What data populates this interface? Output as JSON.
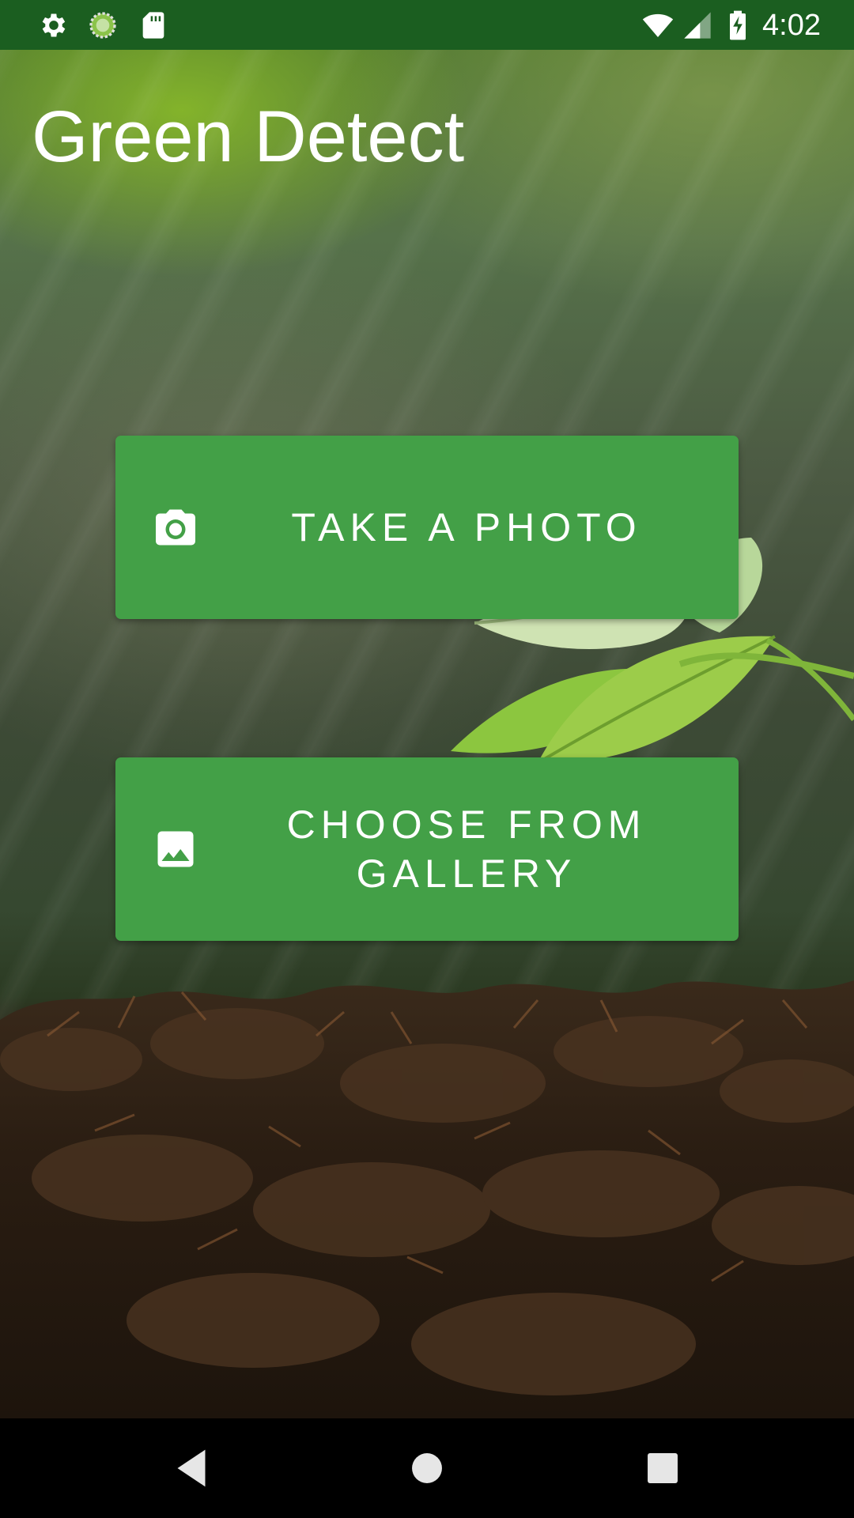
{
  "status_bar": {
    "time": "4:02",
    "left_icons": [
      "settings-icon",
      "sync-icon",
      "sd-card-icon"
    ],
    "right_icons": [
      "wifi-icon",
      "cell-signal-icon",
      "battery-charging-icon"
    ]
  },
  "app": {
    "title": "Green Detect"
  },
  "actions": {
    "take_photo": {
      "label": "TAKE A PHOTO",
      "icon": "camera-icon"
    },
    "choose_gallery": {
      "label": "CHOOSE FROM GALLERY",
      "icon": "image-icon"
    }
  },
  "navigation": {
    "buttons": [
      "back-icon",
      "home-icon",
      "recents-icon"
    ]
  },
  "colors": {
    "status_bar": "#1b5e20",
    "button": "#43a047",
    "button_text": "#ffffff",
    "nav_bar": "#000000"
  }
}
